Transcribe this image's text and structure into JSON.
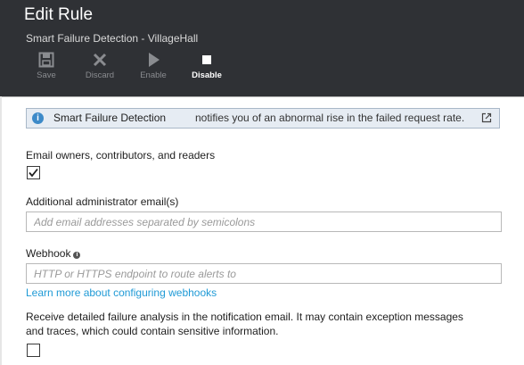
{
  "header": {
    "title": "Edit Rule",
    "subtitle": "Smart Failure Detection - VillageHall",
    "toolbar": {
      "save_label": "Save",
      "discard_label": "Discard",
      "enable_label": "Enable",
      "disable_label": "Disable"
    }
  },
  "info_banner": {
    "highlight": "Smart Failure Detection",
    "text": "notifies you of an abnormal rise in the failed request rate."
  },
  "form": {
    "email_owners_label": "Email owners, contributors, and readers",
    "email_owners_checked": true,
    "admin_email_label": "Additional administrator email(s)",
    "admin_email_placeholder": "Add email addresses separated by semicolons",
    "webhook_label": "Webhook",
    "webhook_placeholder": "HTTP or HTTPS endpoint to route alerts to",
    "webhook_link": "Learn more about configuring webhooks",
    "detailed_analysis_text": "Receive detailed failure analysis in the notification email. It may contain exception messages and traces, which could contain sensitive information.",
    "detailed_analysis_checked": false
  },
  "colors": {
    "header_bg": "#2f3135",
    "link": "#1f9ad6",
    "info_bg": "#e6ecf3",
    "info_icon": "#3d8ac8"
  },
  "icons": {
    "save": "save-icon",
    "discard": "close-icon",
    "enable": "play-icon",
    "disable": "stop-icon",
    "info": "info-icon",
    "external": "external-link-icon",
    "help": "help-icon"
  }
}
